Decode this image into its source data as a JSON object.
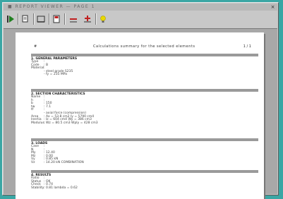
{
  "window": {
    "title": "■ REPORT VIEWER — PAGE 1",
    "close_glyph": "×"
  },
  "toolbar": {
    "buttons": [
      {
        "name": "run-button",
        "icon": "play-icon",
        "color": "#208020"
      },
      {
        "name": "open-button",
        "icon": "open-document-icon",
        "color": "#303030"
      },
      {
        "name": "layout-button",
        "icon": "page-layout-icon",
        "color": "#303030"
      },
      {
        "name": "save-button",
        "icon": "save-icon",
        "color": "#303030"
      },
      {
        "name": "remove-button",
        "icon": "minus-icon",
        "color": "#c02020"
      },
      {
        "name": "add-button",
        "icon": "plus-icon",
        "color": "#c02020"
      },
      {
        "name": "help-button",
        "icon": "lightbulb-icon",
        "color": "#d8c800"
      }
    ]
  },
  "report": {
    "header_left": "#",
    "header_center": "Calculations summary for the selected elements",
    "header_right": "1 / 1",
    "sections": [
      {
        "title": "1. GENERAL PARAMETERS",
        "rows": [
          {
            "k": "Type",
            "v": ":"
          },
          {
            "k": "Code",
            "v": ": B"
          },
          {
            "k": "Material",
            "v": ":"
          },
          {
            "k": "",
            "v": "   - steel grade S235"
          },
          {
            "k": "",
            "v": "   - fy = 235 MPa"
          }
        ]
      },
      {
        "title": "2. SECTION CHARACTERISTICS",
        "rows": [
          {
            "k": "Name",
            "v": ":"
          },
          {
            "k": "h",
            "v": ":"
          },
          {
            "k": "b",
            "v": ":  150"
          },
          {
            "k": "tw",
            "v": ":  7.1"
          },
          {
            "k": "tf",
            "v": ":"
          },
          {
            "k": "",
            "v": "   - axial force (compression)"
          },
          {
            "k": "Area",
            "v": ":  Ax = 53.8 cm2      Iy = 5790 cm4"
          },
          {
            "k": "Inertia",
            "v": ":  Iz = 604 cm4      Wy = 386 cm3"
          },
          {
            "k": "Modulus",
            "v": ":  Wz = 80.5 cm3       Wply = 428 cm3"
          }
        ]
      },
      {
        "title": "3. LOADS",
        "rows": [
          {
            "k": "Case",
            "v": ":"
          },
          {
            "k": "N",
            "v": ":"
          },
          {
            "k": "My",
            "v": ":  12.40"
          },
          {
            "k": "Mz",
            "v": ":  0.00"
          },
          {
            "k": "Vy",
            "v": ":  0.85 kN"
          },
          {
            "k": "Vz",
            "v": ":  14.20 kN   COMBINATION"
          }
        ]
      },
      {
        "title": "4. RESULTS",
        "rows": [
          {
            "k": "Ratio",
            "v": ":"
          },
          {
            "k": "Status",
            "v": ": OK"
          },
          {
            "k": "Check",
            "v": ":  0.74"
          },
          {
            "k": "Stability",
            "v": ":  0.81     lambda = 0.62"
          }
        ]
      }
    ]
  }
}
